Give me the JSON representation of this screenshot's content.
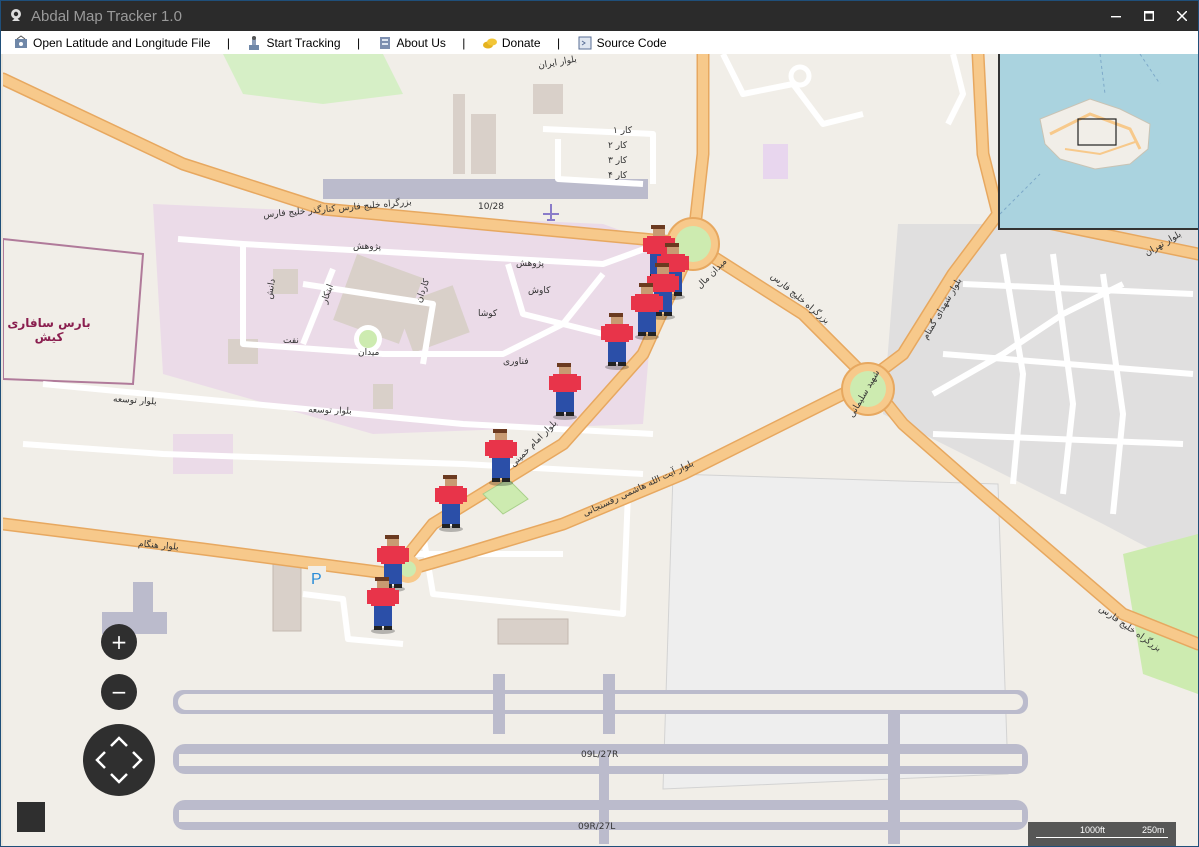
{
  "window": {
    "title": "Abdal Map Tracker 1.0",
    "controls": [
      "minimize-icon",
      "maximize-icon",
      "close-icon"
    ]
  },
  "menu": {
    "items": [
      {
        "label": "Open Latitude and Longitude File",
        "icon": "open-file-icon"
      },
      {
        "label": "Start Tracking",
        "icon": "tracking-icon"
      },
      {
        "label": "About Us",
        "icon": "about-icon"
      },
      {
        "label": "Donate",
        "icon": "coins-icon"
      },
      {
        "label": "Source Code",
        "icon": "source-code-icon"
      }
    ],
    "separator": "|"
  },
  "map": {
    "place_label": "بارس سافاری\nکیش",
    "road_labels": {
      "persian_gulf_boulevard": "بزرگراه خلیج فارس کنارگذر خلیج فارس",
      "persian_gulf_highway": "بزرگراه خلیج فارس",
      "imam_khomeini": "بلوار امام خمینی",
      "hashemi": "بلوار آیت الله هاشمی رفسنجانی",
      "hengam": "بلوار هنگام",
      "tose": "بلوار توسعه",
      "tose2": "بلوار توسعه",
      "runway_top": "10/28",
      "runway_1": "09L/27R",
      "runway_2": "09R/27L",
      "meydan_mall": "میدان مال",
      "pajouhesh": "پژوهش",
      "pajouhesh2": "پژوهش",
      "kavosh": "کاوش",
      "talash": "تلاش",
      "kosha": "کوشا",
      "karadan": "کاردان",
      "fanavari": "فناوری",
      "fanavari2": "فناوری",
      "abtekar": "ابتکار",
      "danesh": "دانش",
      "naft": "نفت",
      "meydan": "میدان",
      "iran": "بلوار ایران",
      "kar1": "کار ۱",
      "kar2": "کار ۲",
      "kar3": "کار ۳",
      "kar4": "کار ۴",
      "kar": "کار ۱",
      "shohada": "بلوار شهدای گمنام",
      "shohada2": "بلوار شهدای گمنام",
      "tehran": "بلوار تهران",
      "shahid": "سرهنگ سهیل",
      "shahid_soleimani": "شهید سلیمانی",
      "khalij_fars_bottom": "بزرگراه خلیج فارس"
    },
    "parking_label": "P",
    "marker_count": 9,
    "colors": {
      "road_major": "#f7c98b",
      "road_major_edge": "#e7a860",
      "water": "#aad3df",
      "runway": "#bbbbcc",
      "residential": "#e0dfdf",
      "industrial": "#ebdbe8",
      "marker_shirt": "#e8344a",
      "marker_pants": "#2b4fa8"
    }
  },
  "controls": {
    "zoom_in": "+",
    "zoom_out": "−",
    "pan_icons": [
      "pan-up-icon",
      "pan-down-icon",
      "pan-left-icon",
      "pan-right-icon"
    ]
  },
  "scale_bar": {
    "imperial": "1000ft",
    "metric": "250m"
  }
}
